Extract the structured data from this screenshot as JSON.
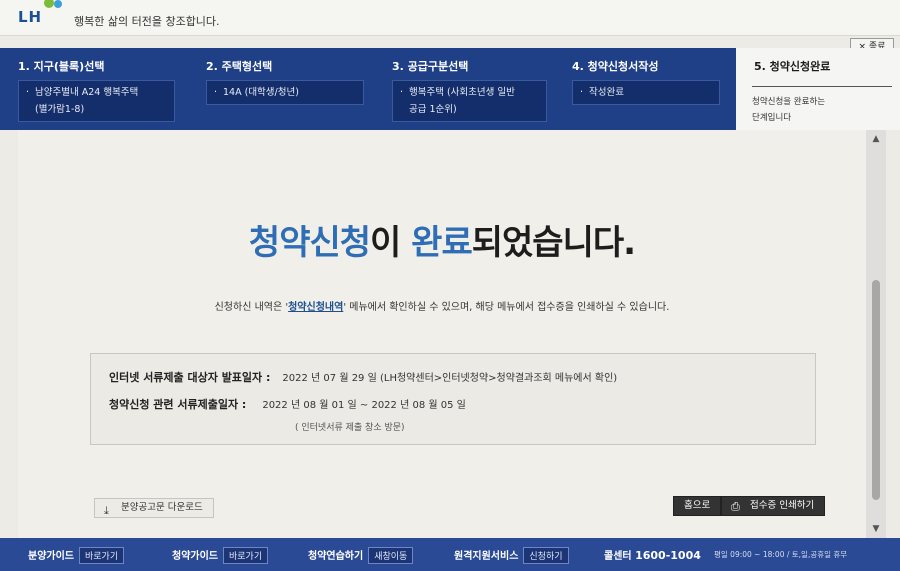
{
  "header": {
    "logo": "LH",
    "slogan": "행복한 삶의 터전을 창조합니다.",
    "close_label": "× 종료"
  },
  "steps": [
    {
      "title": "1. 지구(블록)선택",
      "value_line1": "남양주별내 A24 행복주택",
      "value_line2": "(별가람1-8)"
    },
    {
      "title": "2. 주택형선택",
      "value_line1": "14A (대학생/청년)"
    },
    {
      "title": "3. 공급구분선택",
      "value_line1": "행복주택 (사회초년생 일반",
      "value_line2": "공급 1순위)"
    },
    {
      "title": "4. 청약신청서작성",
      "value_line1": "작성완료"
    },
    {
      "title": "5. 청약신청완료",
      "desc_line1": "청약신청을 완료하는",
      "desc_line2": "단계입니다"
    }
  ],
  "main": {
    "headline_part1": "청약신청",
    "headline_part2": "이 ",
    "headline_part3": "완료",
    "headline_part4": "되었습니다.",
    "sub_before": "신청하신 내역은 '",
    "sub_link": "청약신청내역",
    "sub_after": "' 메뉴에서 확인하실 수 있으며, 해당 메뉴에서 접수증을 인쇄하실 수 있습니다.",
    "info": {
      "row1_label": "인터넷 서류제출 대상자 발표일자 :",
      "row1_value": "2022 년 07 월 29 일 (LH청약센터>인터넷청약>청약결과조회 메뉴에서 확인)",
      "row2_label": "청약신청 관련 서류제출일자 :",
      "row2_value": "2022 년 08 월 01 일 ~ 2022 년 08 월 05 일",
      "note": "( 인터넷서류 제출 창소 방문)"
    },
    "download_label": "분양공고문 다운로드",
    "home_label": "홈으로",
    "print_label": "접수증 인쇄하기"
  },
  "footer": {
    "item1": "분양가이드",
    "item1_btn": "바로가기",
    "item2": "청약가이드",
    "item2_btn": "바로가기",
    "item3": "청약연습하기",
    "item3_btn": "새창이동",
    "item4": "원격지원서비스",
    "item4_btn": "신청하기",
    "phone_label": "콜센터",
    "phone": "1600-1004",
    "hours": "평일 09:00 ~ 18:00 / 토,일,공휴일 휴무"
  },
  "colors": {
    "brand_navy": "#1f3f87",
    "accent_blue": "#2f6db4",
    "footer_blue": "#2a4a95"
  }
}
